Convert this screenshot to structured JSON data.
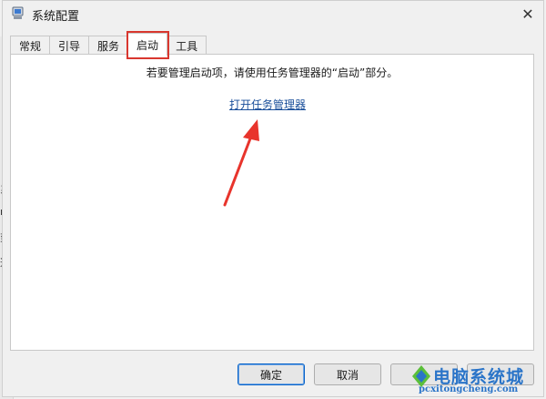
{
  "window": {
    "title": "系统配置"
  },
  "tabs": [
    {
      "label": "常规"
    },
    {
      "label": "引导"
    },
    {
      "label": "服务"
    },
    {
      "label": "启动",
      "active": true
    },
    {
      "label": "工具"
    }
  ],
  "startup": {
    "message": "若要管理启动项，请使用任务管理器的“启动”部分。",
    "link": "打开任务管理器"
  },
  "footer": {
    "ok": "确定",
    "cancel": "取消"
  },
  "background_chars": [
    "系",
    "n",
    "到",
    "选"
  ],
  "watermark": {
    "title": "电脑系统城",
    "url": "pcxitongcheng.com"
  },
  "colors": {
    "highlight": "#d9372f",
    "link": "#1a4f9a",
    "watermark": "#2a74c8"
  }
}
